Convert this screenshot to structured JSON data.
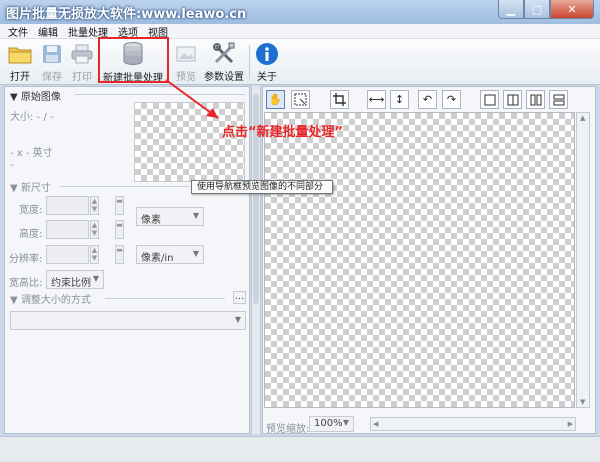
{
  "window": {
    "title": "图片批量无损放大软件:www.leawo.cn"
  },
  "menu": [
    "文件",
    "编辑",
    "批量处理",
    "选项",
    "视图"
  ],
  "toolbar": {
    "open": "打开",
    "save": "保存",
    "print": "打印",
    "new_batch": "新建批量处理",
    "preview": "预览",
    "settings": "参数设置",
    "about": "关于"
  },
  "original": {
    "header": "▼ 原始图像",
    "size": "大小: - / -",
    "dims": "- x - 英寸",
    "dash": "-"
  },
  "newsize": {
    "header": "▼ 新尺寸",
    "width_label": "宽度:",
    "height_label": "高度:",
    "res_label": "分辨率:",
    "unit_selected": "像素",
    "res_unit_selected": "像素/in",
    "aspect_label": "宽高比:",
    "aspect_selected": "约束比例"
  },
  "resize_method": {
    "header": "▼ 调整大小的方式",
    "more": "..."
  },
  "tooltip": "使用导航框预览图像的不同部分",
  "annotation": "点击“新建批量处理”",
  "preview_zoom": {
    "label": "预览缩放:",
    "value": "100%"
  },
  "colors": {
    "annotation_red": "#e8262a",
    "about_blue": "#1f6fd1"
  }
}
